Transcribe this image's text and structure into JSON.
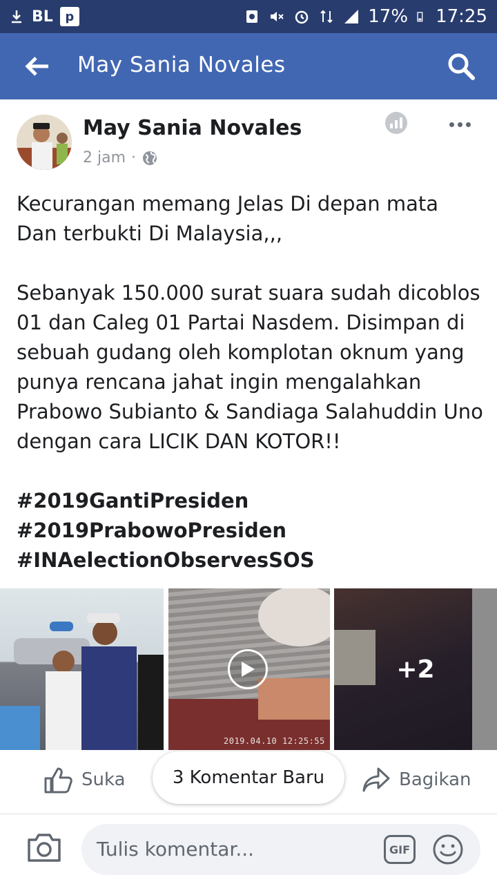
{
  "status_bar": {
    "carrier": "BL",
    "battery": "17%",
    "time": "17:25"
  },
  "app_bar": {
    "title": "May Sania Novales"
  },
  "post": {
    "author": "May Sania Novales",
    "time_ago": "2 jam",
    "separator": "·",
    "paragraphs": [
      "Kecurangan memang Jelas Di depan mata Dan terbukti Di Malaysia,,,",
      "Sebanyak 150.000 surat suara sudah dicoblos 01 dan Caleg 01 Partai Nasdem. Disimpan di sebuah gudang oleh komplotan oknum yang punya rencana jahat ingin mengalahkan Prabowo Subianto & Sandiaga Salahuddin Uno dengan cara LICIK DAN KOTOR!!"
    ],
    "hashtags": [
      "#2019GantiPresiden",
      "#2019PrabowoPresiden",
      "#INAelectionObservesSOS"
    ],
    "media": {
      "video_timestamp": "2019.04.10 12:25:55",
      "more_count": "+2"
    }
  },
  "actions": {
    "like": "Suka",
    "new_comments": "3 Komentar Baru",
    "share": "Bagikan"
  },
  "comment_bar": {
    "placeholder": "Tulis komentar...",
    "gif": "GIF"
  }
}
